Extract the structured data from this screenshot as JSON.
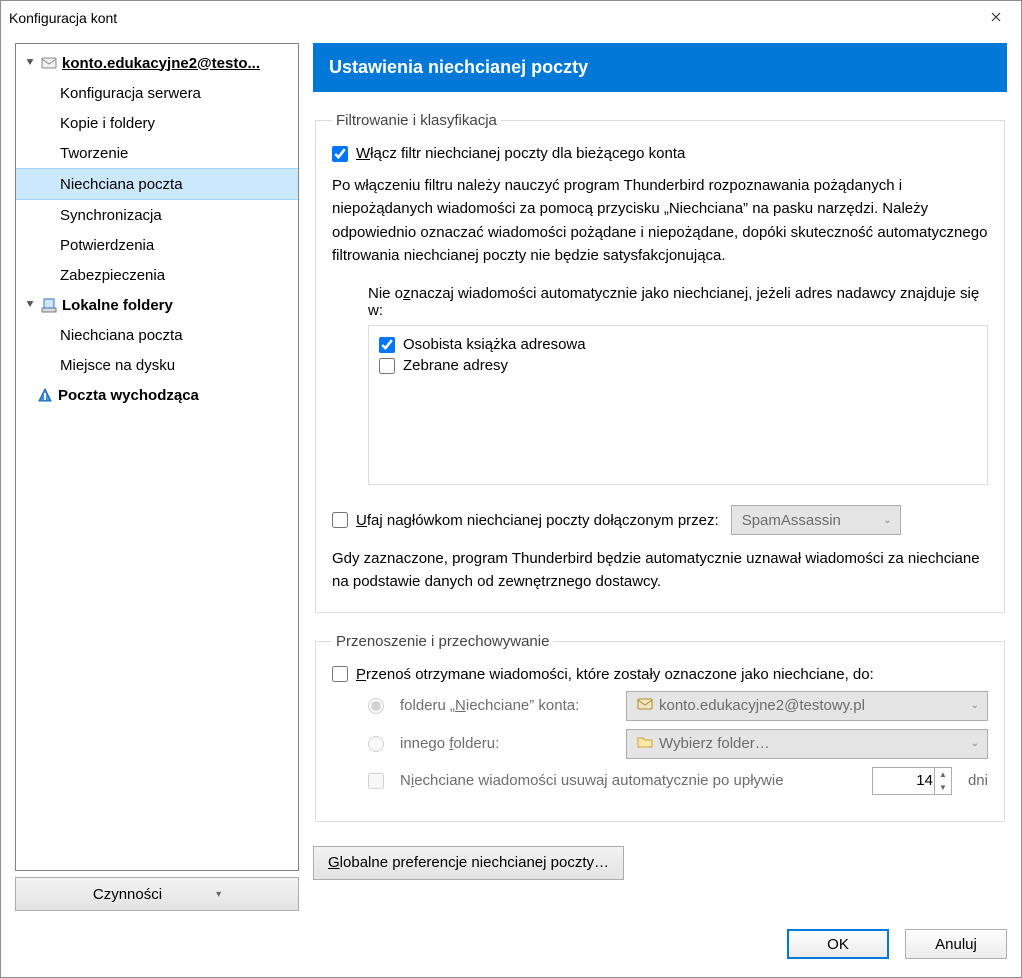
{
  "window": {
    "title": "Konfiguracja kont"
  },
  "sidebar": {
    "account_name": "konto.edukacyjne2@testo...",
    "items": {
      "server": "Konfiguracja serwera",
      "copies": "Kopie i foldery",
      "compose": "Tworzenie",
      "junk": "Niechciana poczta",
      "sync": "Synchronizacja",
      "receipts": "Potwierdzenia",
      "security": "Zabezpieczenia"
    },
    "local_folders": "Lokalne foldery",
    "local_junk": "Niechciana poczta",
    "disk_space": "Miejsce na dysku",
    "outgoing": "Poczta wychodząca",
    "actions_button": "Czynności"
  },
  "header": {
    "title": "Ustawienia niechcianej poczty"
  },
  "filter": {
    "legend": "Filtrowanie i klasyfikacja",
    "enable_prefix": "W",
    "enable_rest": "łącz filtr niechcianej poczty dla bieżącego konta",
    "description": "Po włączeniu filtru należy nauczyć program Thunderbird rozpoznawania pożądanych i niepożądanych wiadomości za pomocą przycisku „Niechciana” na pasku narzędzi. Należy odpowiednio oznaczać wiadomości pożądane i niepożądane, dopóki skuteczność automatycznego filtrowania niechcianej poczty nie będzie satysfakcjonująca.",
    "whitelist_msg_pre": "Nie o",
    "whitelist_msg_u": "z",
    "whitelist_msg_post": "naczaj wiadomości automatycznie jako niechcianej, jeżeli adres nadawcy znajduje się w:",
    "book_personal": "Osobista książka adresowa",
    "book_collected": "Zebrane adresy",
    "trust_pre": "U",
    "trust_rest": "faj nagłówkom niechcianej poczty dołączonym przez:",
    "trust_provider": "SpamAssassin",
    "trust_desc": "Gdy zaznaczone, program Thunderbird będzie automatycznie uznawał wiadomości za niechciane na podstawie danych od zewnętrznego dostawcy."
  },
  "dest": {
    "legend": "Przenoszenie i przechowywanie",
    "move_pre": "P",
    "move_rest": "rzenoś otrzymane wiadomości, które zostały oznaczone jako niechciane, do:",
    "junk_folder_label_pre": "folderu „",
    "junk_folder_label_u": "N",
    "junk_folder_label_post": "iechciane” konta:",
    "junk_folder_account": "konto.edukacyjne2@testowy.pl",
    "other_folder_label_pre": "innego ",
    "other_folder_label_u": "f",
    "other_folder_label_post": "olderu:",
    "other_folder_value": "Wybierz folder…",
    "delete_pre": "N",
    "delete_u": "i",
    "delete_rest": "echciane wiadomości usuwaj automatycznie po upływie",
    "days_value": "14",
    "days_unit": "dni"
  },
  "global_button_pre": "G",
  "global_button_rest": "lobalne preferencje niechcianej poczty…",
  "footer": {
    "ok": "OK",
    "cancel": "Anuluj"
  }
}
